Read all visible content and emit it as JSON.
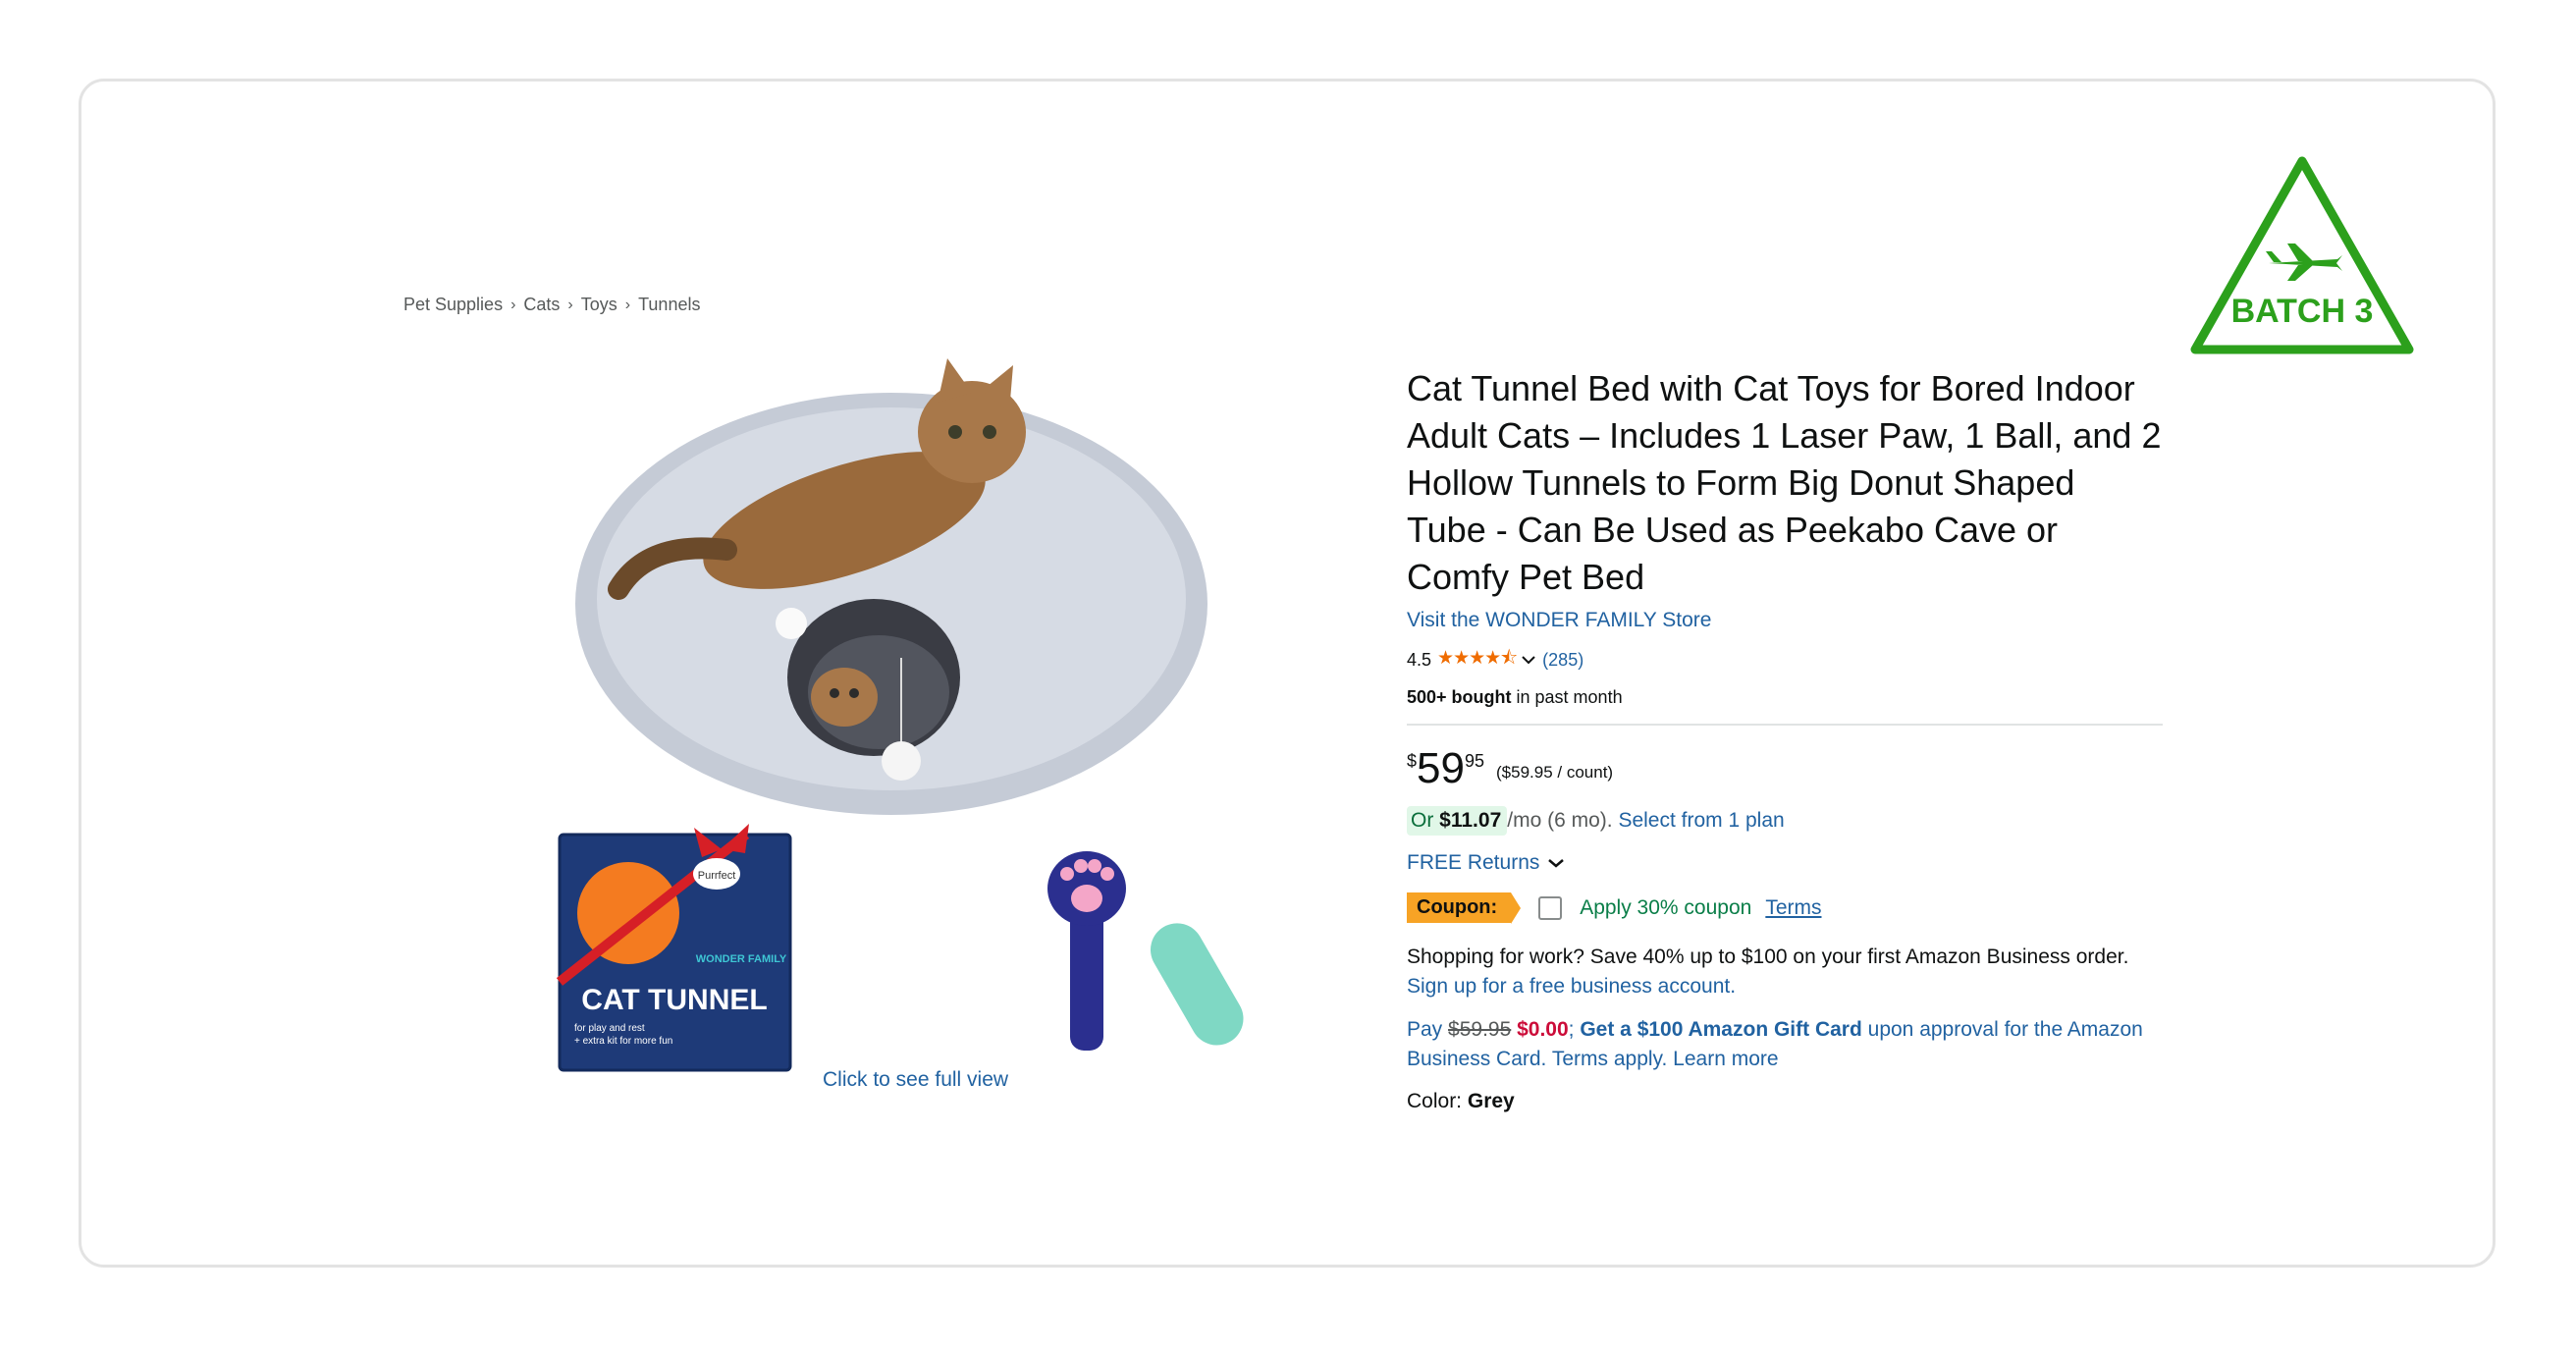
{
  "breadcrumb": [
    "Pet Supplies",
    "Cats",
    "Toys",
    "Tunnels"
  ],
  "gallery": {
    "box_brand": "WONDER FAMILY",
    "box_title": "CAT TUNNEL",
    "box_sub1": "for play and rest",
    "box_sub2": "+ extra kit for more fun",
    "box_bubble": "Purrfect",
    "caption": "Click to see full view"
  },
  "badge": {
    "text": "BATCH 3",
    "color": "#2ca01c"
  },
  "product": {
    "title": "Cat Tunnel Bed with Cat Toys for Bored Indoor Adult Cats – Includes 1 Laser Paw, 1 Ball, and 2 Hollow Tunnels to Form Big Donut Shaped Tube - Can Be Used as Peekabo Cave or Comfy Pet Bed",
    "store_link": "Visit the WONDER FAMILY Store",
    "rating": "4.5",
    "stars": "★★★★⯪",
    "rating_count": "(285)",
    "bought_strong": "500+ bought",
    "bought_rest": " in past month"
  },
  "price": {
    "symbol": "$",
    "whole": "59",
    "fraction": "95",
    "unit_price": "($59.95 / count)",
    "monthly_prefix": "Or ",
    "monthly_amount": "$11.07",
    "monthly_suffix": "/mo (6 mo).",
    "plan_link": "Select from 1 plan"
  },
  "returns": "FREE Returns",
  "coupon": {
    "label": "Coupon:",
    "apply": "Apply 30% coupon",
    "terms": "Terms"
  },
  "business": {
    "text": "Shopping for work? Save 40% up to $100 on your first Amazon Business order.",
    "link": "Sign up for a free business account."
  },
  "pay": {
    "prefix": "Pay ",
    "old": "$59.95",
    "new": "$0.00",
    "sep": "; ",
    "gift": "Get a $100 Amazon Gift Card",
    "rest": " upon approval for the Amazon Business Card. Terms apply. Learn more"
  },
  "color": {
    "label": "Color: ",
    "value": "Grey"
  }
}
